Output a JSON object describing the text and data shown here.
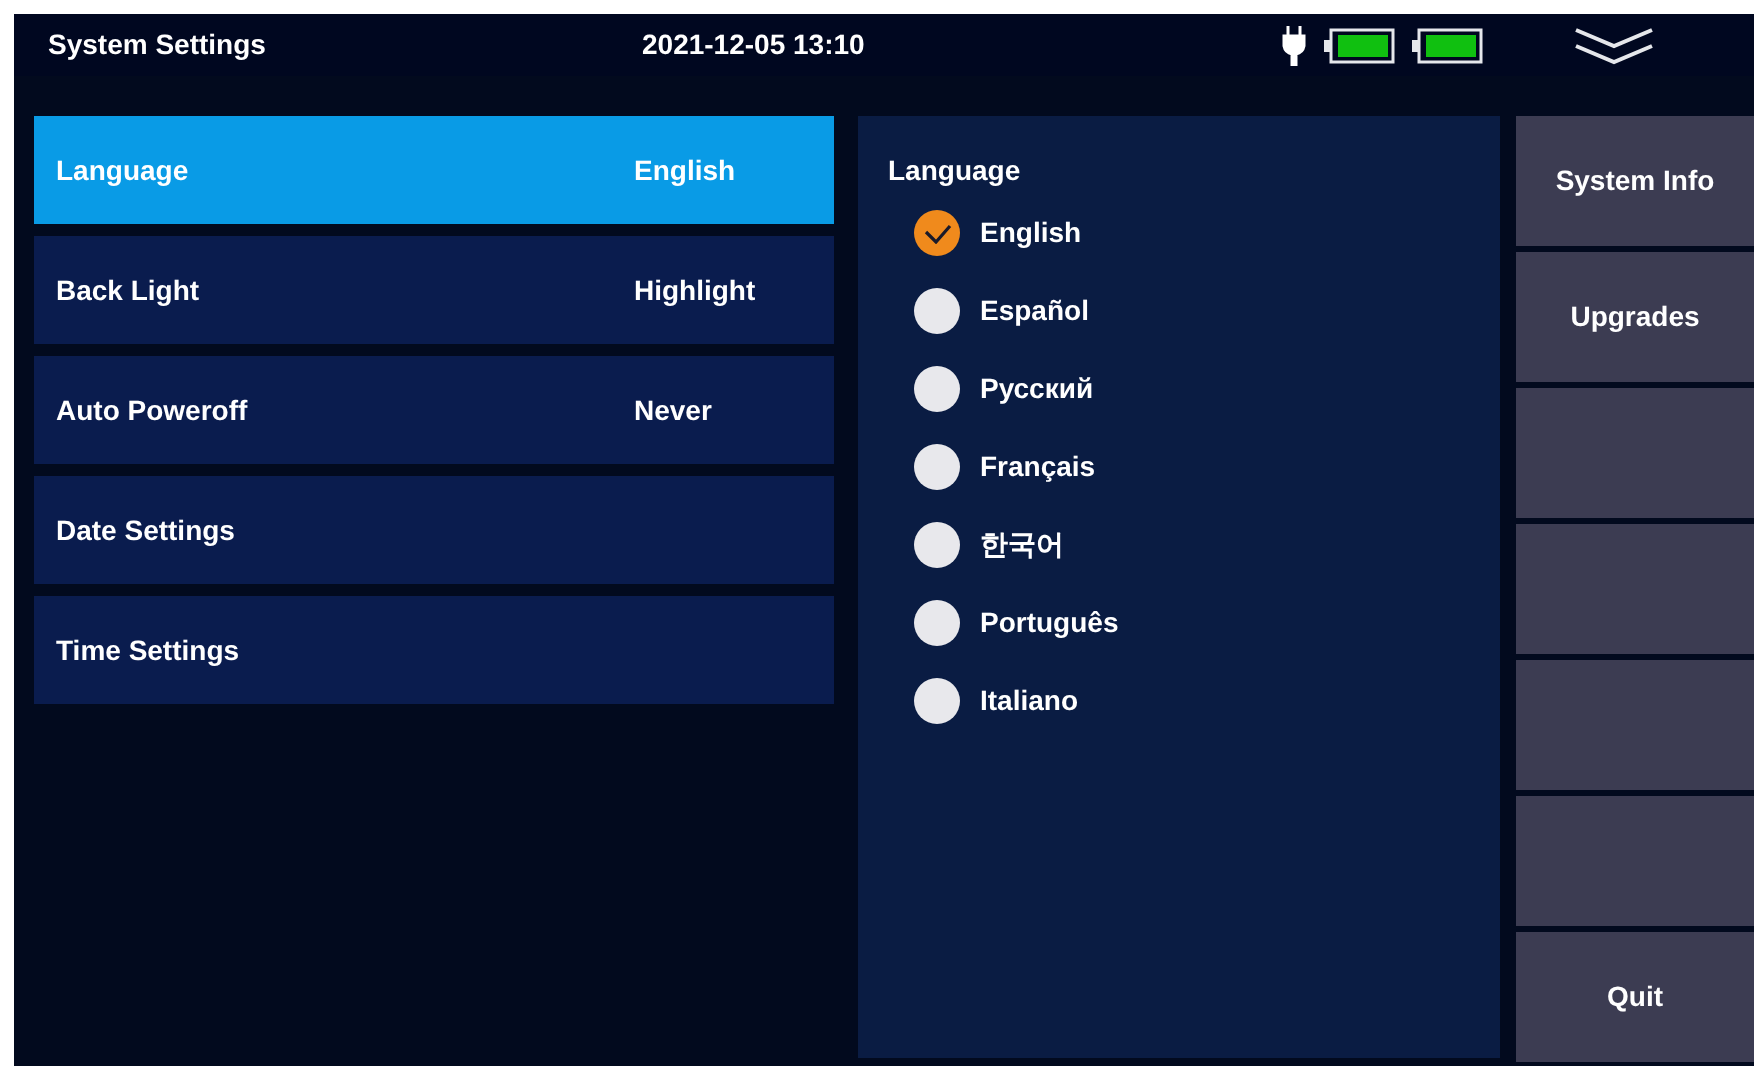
{
  "header": {
    "title": "System Settings",
    "datetime": "2021-12-05 13:10"
  },
  "settings": [
    {
      "label": "Language",
      "value": "English",
      "selected": true
    },
    {
      "label": "Back Light",
      "value": "Highlight",
      "selected": false
    },
    {
      "label": "Auto Poweroff",
      "value": "Never",
      "selected": false
    },
    {
      "label": "Date Settings",
      "selected": false
    },
    {
      "label": "Time Settings",
      "selected": false
    }
  ],
  "language_panel": {
    "title": "Language",
    "options": [
      {
        "label": "English",
        "selected": true
      },
      {
        "label": "Español",
        "selected": false
      },
      {
        "label": "Русский",
        "selected": false
      },
      {
        "label": "Français",
        "selected": false
      },
      {
        "label": "한국어",
        "selected": false
      },
      {
        "label": "Português",
        "selected": false
      },
      {
        "label": "Italiano",
        "selected": false
      }
    ]
  },
  "side_buttons": [
    {
      "kind": "labeled",
      "label": "System Info"
    },
    {
      "kind": "labeled",
      "label": "Upgrades"
    },
    {
      "kind": "blank"
    },
    {
      "kind": "blank"
    },
    {
      "kind": "blank"
    },
    {
      "kind": "blank"
    },
    {
      "kind": "labeled",
      "label": "Quit"
    }
  ]
}
